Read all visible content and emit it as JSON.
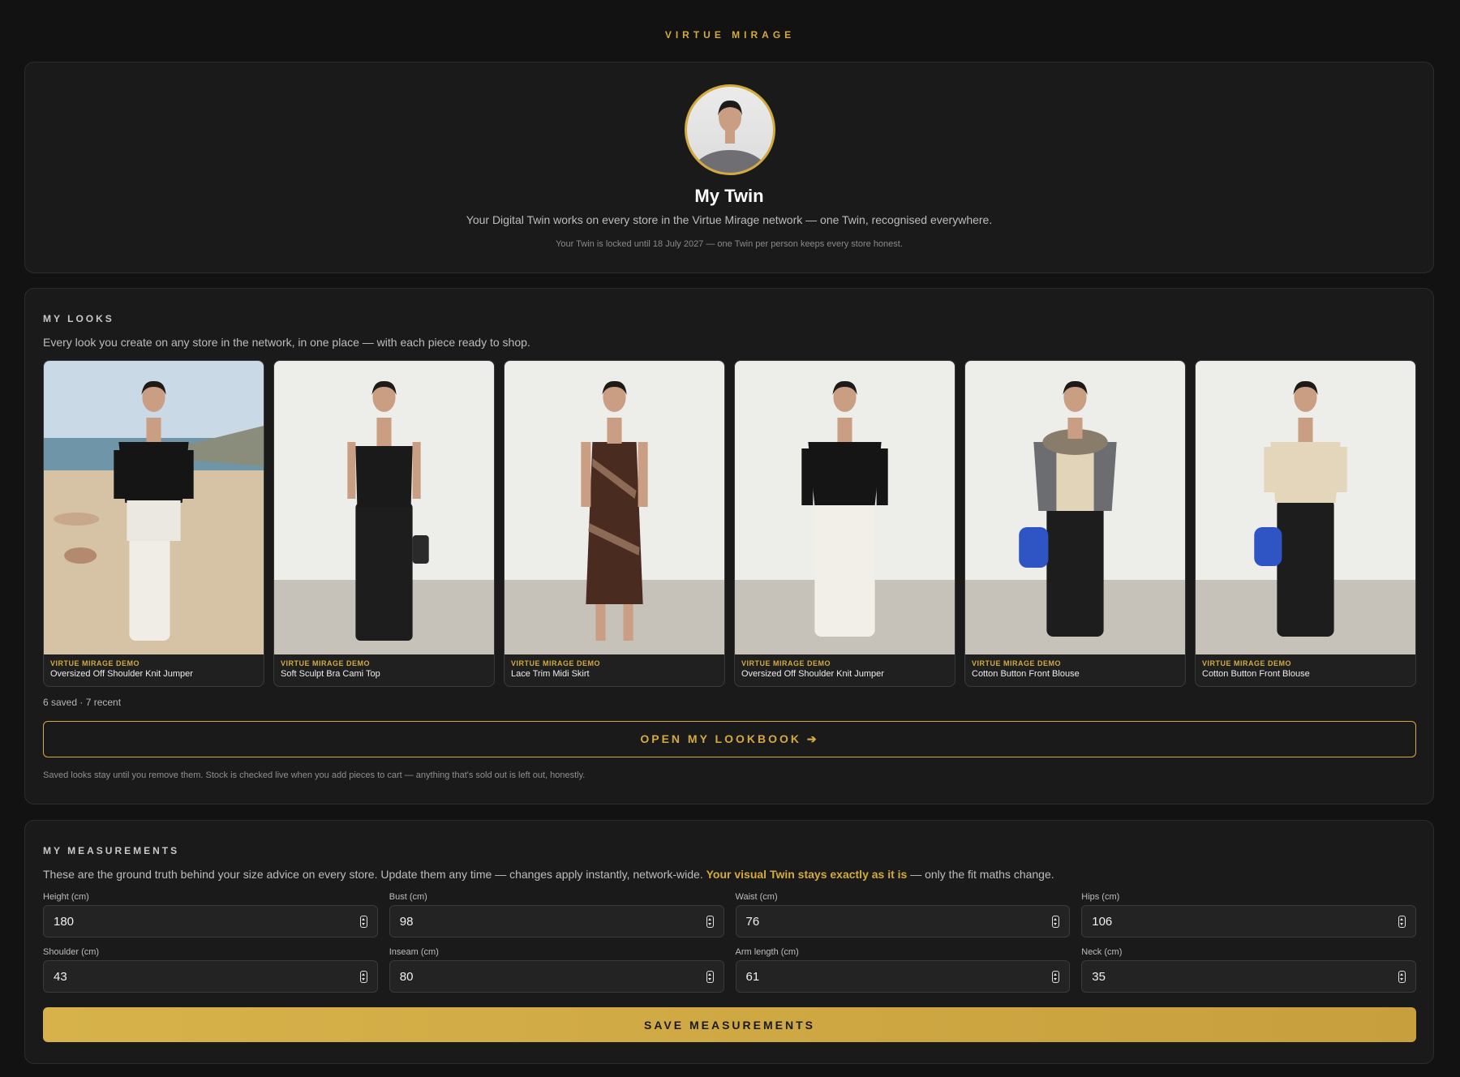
{
  "brand": "VIRTUE MIRAGE",
  "twin": {
    "title": "My Twin",
    "description": "Your Digital Twin works on every store in the Virtue Mirage network — one Twin, recognised everywhere.",
    "lock_note": "Your Twin is locked until 18 July 2027 — one Twin per person keeps every store honest."
  },
  "looks": {
    "section_title": "MY LOOKS",
    "description": "Every look you create on any store in the network, in one place — with each piece ready to shop.",
    "items": [
      {
        "store": "VIRTUE MIRAGE DEMO",
        "name": "Oversized Off Shoulder Knit Jumper"
      },
      {
        "store": "VIRTUE MIRAGE DEMO",
        "name": "Soft Sculpt Bra Cami Top"
      },
      {
        "store": "VIRTUE MIRAGE DEMO",
        "name": "Lace Trim Midi Skirt"
      },
      {
        "store": "VIRTUE MIRAGE DEMO",
        "name": "Oversized Off Shoulder Knit Jumper"
      },
      {
        "store": "VIRTUE MIRAGE DEMO",
        "name": "Cotton Button Front Blouse"
      },
      {
        "store": "VIRTUE MIRAGE DEMO",
        "name": "Cotton Button Front Blouse"
      }
    ],
    "count_text": "6 saved · 7 recent",
    "open_button": "OPEN MY LOOKBOOK ➔",
    "note": "Saved looks stay until you remove them. Stock is checked live when you add pieces to cart — anything that's sold out is left out, honestly."
  },
  "measurements": {
    "section_title": "MY MEASUREMENTS",
    "description_start": "These are the ground truth behind your size advice on every store. Update them any time — changes apply instantly, network-wide. ",
    "description_highlight": "Your visual Twin stays exactly as it is",
    "description_end": " — only the fit maths change.",
    "fields": [
      {
        "label": "Height (cm)",
        "value": "180"
      },
      {
        "label": "Bust (cm)",
        "value": "98"
      },
      {
        "label": "Waist (cm)",
        "value": "76"
      },
      {
        "label": "Hips (cm)",
        "value": "106"
      },
      {
        "label": "Shoulder (cm)",
        "value": "43"
      },
      {
        "label": "Inseam (cm)",
        "value": "80"
      },
      {
        "label": "Arm length (cm)",
        "value": "61"
      },
      {
        "label": "Neck (cm)",
        "value": "35"
      }
    ],
    "save_button": "SAVE MEASUREMENTS"
  },
  "colors": {
    "accent": "#d4aa3e",
    "background": "#121212",
    "card": "#1a1a1a"
  }
}
